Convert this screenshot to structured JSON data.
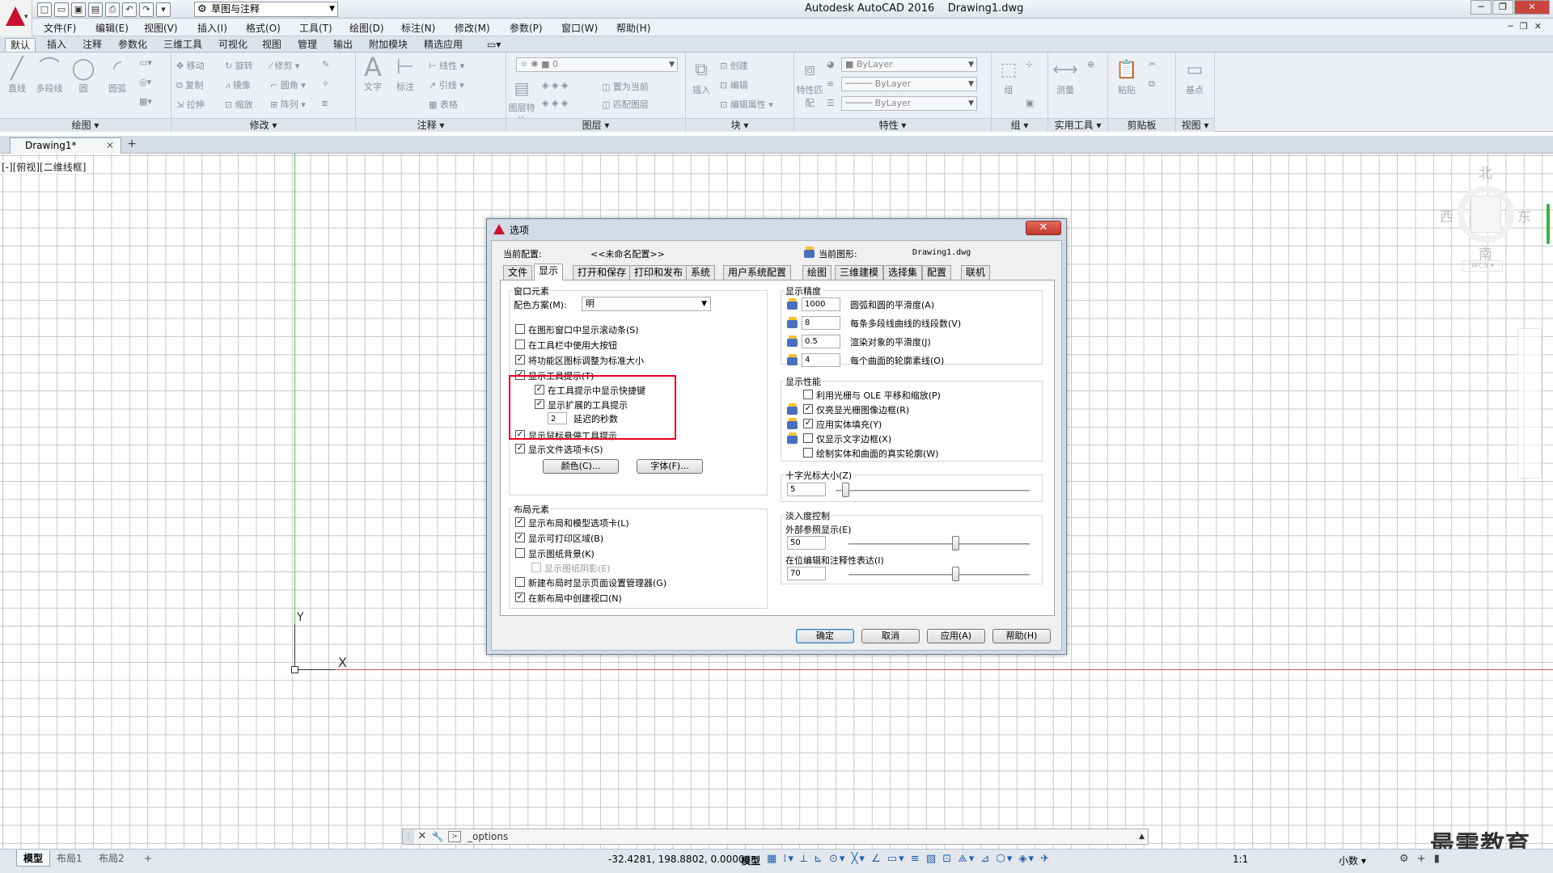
{
  "window": {
    "title": "Autodesk AutoCAD 2016",
    "file": "Drawing1.dwg",
    "workspace": "草图与注释"
  },
  "menu": [
    "文件(F)",
    "编辑(E)",
    "视图(V)",
    "插入(I)",
    "格式(O)",
    "工具(T)",
    "绘图(D)",
    "标注(N)",
    "修改(M)",
    "参数(P)",
    "窗口(W)",
    "帮助(H)"
  ],
  "ribbon_tabs": [
    "默认",
    "插入",
    "注释",
    "参数化",
    "三维工具",
    "可视化",
    "视图",
    "管理",
    "输出",
    "附加模块",
    "精选应用"
  ],
  "ribbon": {
    "draw": {
      "title": "绘图",
      "items": [
        "直线",
        "多段线",
        "圆",
        "圆弧"
      ]
    },
    "modify": {
      "title": "修改",
      "items": [
        "移动",
        "旋转",
        "修剪",
        "复制",
        "镜像",
        "圆角",
        "拉伸",
        "缩放",
        "阵列"
      ]
    },
    "annotate": {
      "title": "注释",
      "items": [
        "文字",
        "标注",
        "线性",
        "引线",
        "表格"
      ]
    },
    "layers": {
      "title": "图层",
      "items": [
        "图层特性",
        "置为当前",
        "匹配图层"
      ],
      "current_layer": "0"
    },
    "block": {
      "title": "块",
      "items": [
        "插入",
        "创建",
        "编辑",
        "编辑属性"
      ]
    },
    "properties": {
      "title": "特性",
      "items": [
        "特性匹配"
      ],
      "color": "ByLayer",
      "linetype": "ByLayer",
      "lineweight": "ByLayer"
    },
    "groups": {
      "title": "组",
      "items": [
        "组"
      ]
    },
    "utilities": {
      "title": "实用工具",
      "items": [
        "测量"
      ]
    },
    "clipboard": {
      "title": "剪贴板",
      "items": [
        "粘贴"
      ]
    },
    "view": {
      "title": "视图",
      "items": [
        "基点"
      ]
    }
  },
  "doc_tab": "Drawing1*",
  "viewport_label": "[-][俯视][二维线框]",
  "ucs": {
    "x": "X",
    "y": "Y"
  },
  "viewcube": {
    "north": "北",
    "south": "南",
    "east": "东",
    "west": "西",
    "wcs": "WCS"
  },
  "dialog": {
    "title": "选项",
    "current_profile_label": "当前配置:",
    "current_profile": "<<未命名配置>>",
    "current_drawing_label": "当前图形:",
    "current_drawing": "Drawing1.dwg",
    "tabs": [
      "文件",
      "显示",
      "打开和保存",
      "打印和发布",
      "系统",
      "用户系统配置",
      "绘图",
      "三维建模",
      "选择集",
      "配置",
      "联机"
    ],
    "active_tab": "显示",
    "window_elements": {
      "title": "窗口元素",
      "color_scheme_label": "配色方案(M):",
      "color_scheme": "明",
      "checks": [
        {
          "label": "在图形窗口中显示滚动条(S)",
          "checked": false
        },
        {
          "label": "在工具栏中使用大按钮",
          "checked": false
        },
        {
          "label": "将功能区图标调整为标准大小",
          "checked": true
        },
        {
          "label": "显示工具提示(T)",
          "checked": true
        },
        {
          "label": "在工具提示中显示快捷键",
          "checked": true
        },
        {
          "label": "显示扩展的工具提示",
          "checked": true
        },
        {
          "label": "显示鼠标悬停工具提示",
          "checked": true
        },
        {
          "label": "显示文件选项卡(S)",
          "checked": true
        }
      ],
      "delay_value": "2",
      "delay_label": "延迟的秒数",
      "colors_button": "颜色(C)...",
      "fonts_button": "字体(F)..."
    },
    "layout_elements": {
      "title": "布局元素",
      "checks": [
        {
          "label": "显示布局和模型选项卡(L)",
          "checked": true
        },
        {
          "label": "显示可打印区域(B)",
          "checked": true
        },
        {
          "label": "显示图纸背景(K)",
          "checked": false
        },
        {
          "label": "显示图纸阴影(E)",
          "checked": false
        },
        {
          "label": "新建布局时显示页面设置管理器(G)",
          "checked": false
        },
        {
          "label": "在新布局中创建视口(N)",
          "checked": true
        }
      ]
    },
    "display_resolution": {
      "title": "显示精度",
      "rows": [
        {
          "value": "1000",
          "label": "圆弧和圆的平滑度(A)"
        },
        {
          "value": "8",
          "label": "每条多段线曲线的线段数(V)"
        },
        {
          "value": "0.5",
          "label": "渲染对象的平滑度(J)"
        },
        {
          "value": "4",
          "label": "每个曲面的轮廓素线(O)"
        }
      ]
    },
    "display_performance": {
      "title": "显示性能",
      "checks": [
        {
          "label": "利用光栅与 OLE 平移和缩放(P)",
          "checked": false
        },
        {
          "label": "仅亮显光栅图像边框(R)",
          "checked": true
        },
        {
          "label": "应用实体填充(Y)",
          "checked": true
        },
        {
          "label": "仅显示文字边框(X)",
          "checked": false
        },
        {
          "label": "绘制实体和曲面的真实轮廓(W)",
          "checked": false
        }
      ]
    },
    "crosshair": {
      "title": "十字光标大小(Z)",
      "value": "5",
      "fraction": 0.05
    },
    "fade_control": {
      "title": "淡入度控制",
      "xref_label": "外部参照显示(E)",
      "xref_value": "50",
      "xref_fraction": 0.59,
      "inplace_label": "在位编辑和注释性表达(I)",
      "inplace_value": "70",
      "inplace_fraction": 0.59
    },
    "buttons": {
      "ok": "确定",
      "cancel": "取消",
      "apply": "应用(A)",
      "help": "帮助(H)"
    }
  },
  "command_line": {
    "text": "_options"
  },
  "status": {
    "layout_tabs": [
      "模型",
      "布局1",
      "布局2"
    ],
    "coords": "-32.4281, 198.8802, 0.0000",
    "mode": "模型",
    "scale": "1:1",
    "units": "小数"
  },
  "watermark": "最需教育"
}
